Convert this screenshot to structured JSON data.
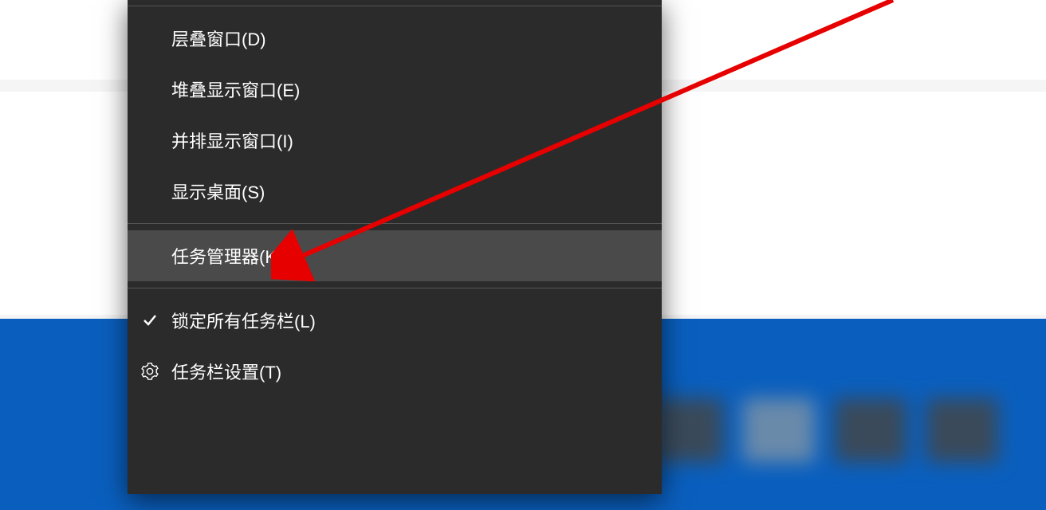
{
  "menu": {
    "items": [
      {
        "label": "层叠窗口(D)"
      },
      {
        "label": "堆叠显示窗口(E)"
      },
      {
        "label": "并排显示窗口(I)"
      },
      {
        "label": "显示桌面(S)"
      },
      {
        "label": "任务管理器(K)",
        "highlighted": true
      },
      {
        "label": "锁定所有任务栏(L)",
        "icon": "checkmark"
      },
      {
        "label": "任务栏设置(T)",
        "icon": "gear"
      }
    ]
  },
  "annotation": {
    "arrow_color": "#e60000"
  }
}
